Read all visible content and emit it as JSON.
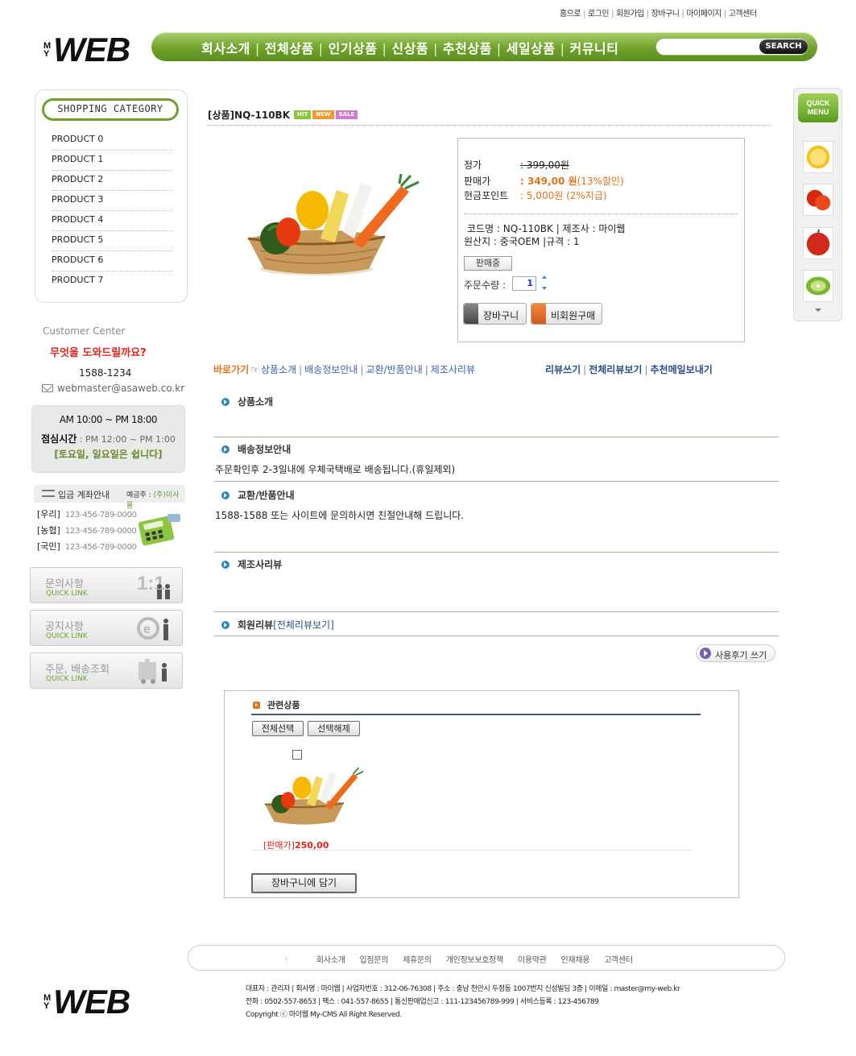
{
  "top_links": [
    "홈으로",
    "로그인",
    "회원가입",
    "장바구니",
    "마이페이지",
    "고객센터"
  ],
  "logo": {
    "my": [
      "M",
      "Y"
    ],
    "web": "WEB"
  },
  "nav": {
    "items": [
      "회사소개",
      "전체상품",
      "인기상품",
      "신상품",
      "추천상품",
      "세일상품",
      "커뮤니티"
    ],
    "search_button": "SEARCH",
    "search_value": ""
  },
  "category": {
    "title": "SHOPPING CATEGORY",
    "items": [
      "PRODUCT  0",
      "PRODUCT 1",
      "PRODUCT  2",
      "PRODUCT  3",
      "PRODUCT  4",
      "PRODUCT  5",
      "PRODUCT  6",
      "PRODUCT  7"
    ]
  },
  "customer_center": {
    "title": "Customer Center",
    "help": "무엇을 도와드릴까요?",
    "phone": "1588-1234",
    "email": "webmaster@asaweb.co.kr",
    "hours": "AM 10:00 ~ PM 18:00",
    "lunch_label": "점심시간",
    "lunch": " : PM 12:00 ~ PM 1:00",
    "closed": "[토요일, 일요일은 쉽니다]"
  },
  "bank": {
    "title": "입금 계좌안내",
    "owner_label": "예금주 : ",
    "owner": "(주)이사몰",
    "accounts": [
      {
        "bank": "[우리]",
        "number": "123-456-789-0000"
      },
      {
        "bank": "[농협]",
        "number": "123-456-789-0000"
      },
      {
        "bank": "[국민]",
        "number": "123-456-789-0000"
      }
    ]
  },
  "quick_links": [
    {
      "title": "문의사항",
      "sub": "QUICK LINK"
    },
    {
      "title": "공지사항",
      "sub": "QUICK LINK"
    },
    {
      "title": "주문, 배송조회",
      "sub": "QUICK LINK"
    }
  ],
  "product": {
    "title": "[상품]NQ-110BK",
    "badges": [
      "HIT",
      "NEW",
      "SALE"
    ],
    "list_price_label": "정가",
    "list_price": ": 399,00원",
    "sale_price_label": "판매가",
    "sale_colon": ": ",
    "sale_price": "349,00  원",
    "discount": "(13%할인)",
    "point_label": "현금포인트",
    "point": ": 5,000원 (2%지급)",
    "code_line": "코드명 : NQ-110BK | 제조사 : 마이웹",
    "origin_line": "원산지 : 중국OEM |규격 : 1",
    "status": "판매중",
    "qty_label": "주문수량 :",
    "qty": "1",
    "cart_button": "장바구니",
    "guest_button": "비회원구매"
  },
  "quick_nav": {
    "title": "바로가기",
    "links": [
      "상품소개",
      "배송정보안내",
      "교환/반품안내",
      "제조사리뷰"
    ],
    "review_links": [
      "리뷰쓰기",
      "전체리뷰보기",
      "추천메일보내기"
    ]
  },
  "sections": {
    "intro": {
      "title": "상품소개",
      "body": ""
    },
    "shipping": {
      "title": "배송정보안내",
      "body": "주문확인후 2-3일내에 우체국택배로 배송됩니다.(휴일제외)"
    },
    "exchange": {
      "title": "교환/반품안내",
      "body": "1588-1588 또는 사이트에 문의하시면 친절안내해 드립니다."
    },
    "maker_review": {
      "title": "제조사리뷰",
      "body": ""
    },
    "member_review": {
      "title": "회원리뷰 ",
      "link": "[전체리뷰보기]"
    }
  },
  "review_write_button": "사용후기 쓰기",
  "related": {
    "title": "관련상품",
    "select_all": "전체선택",
    "deselect": "선택해제",
    "price_label": "[판매가]",
    "price": "250,00",
    "cart_button": "장바구니에 담기"
  },
  "quick_menu": {
    "title_line1": "QUICK",
    "title_line2": "MENU"
  },
  "footer": {
    "links": [
      "회사소개",
      "입점문의",
      "제휴문의",
      "개인정보보호정책",
      "이용약관",
      "인재채용",
      "고객센터"
    ],
    "line1": "대표자 : 관리자  | 회사명 : 마이웹  | 사업자번호 : 312-06-76308  | 주소 : 충남 천안시 두정동 1007번지 신성빌딩 3층  | 이메일 : master@my-web.kr",
    "line2": "전화 : 0502-557-8653   | 팩스 : 041-557-8655 | 통신판매업신고 : 111-123456789-999 | 서비스등록 : 123-456789",
    "line3": "Copyright ⓒ 마이웹 My-CMS All Right Reserved."
  },
  "colors": {
    "brand_green": "#6fa12b",
    "accent_orange": "#e2711a",
    "link_blue": "#3b63a5",
    "help_red": "#e2231a"
  }
}
